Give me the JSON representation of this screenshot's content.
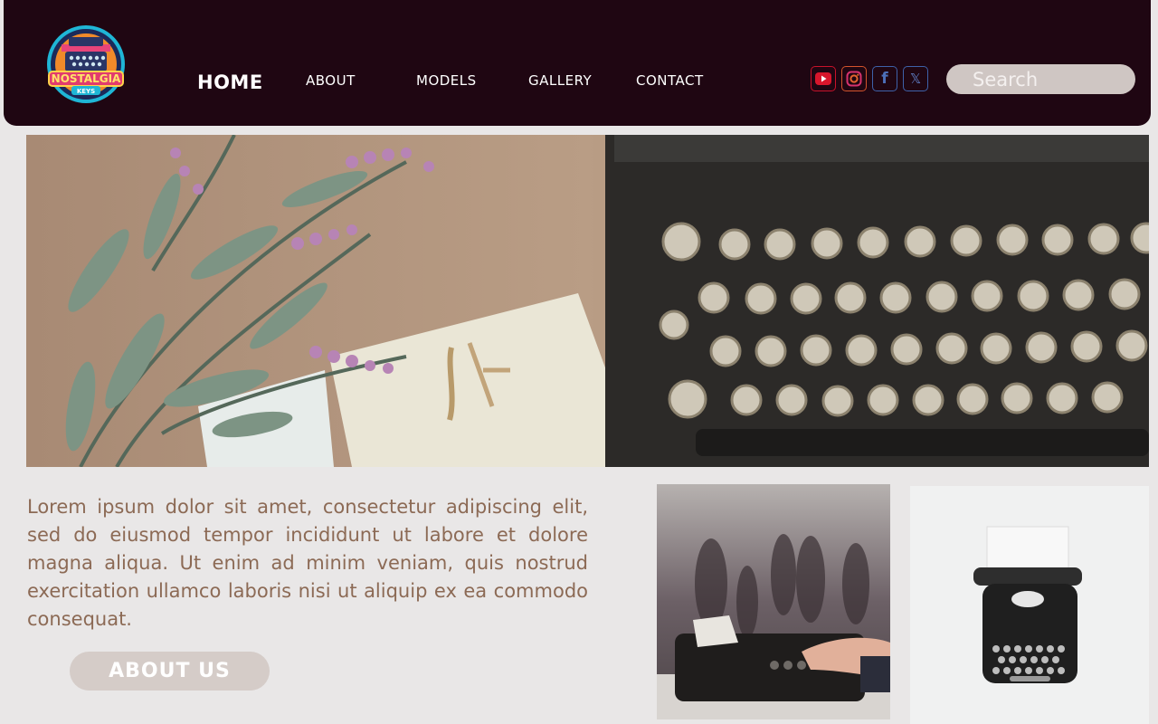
{
  "brand": {
    "logo_text_1": "NOSTALGIA",
    "logo_text_2": "KEYS"
  },
  "nav": {
    "home": "HOME",
    "about": "ABOUT",
    "models": "MODELS",
    "gallery": "GALLERY",
    "contact": "CONTACT"
  },
  "social": {
    "youtube_icon": "youtube-icon",
    "instagram_icon": "instagram-icon",
    "facebook_icon": "facebook-icon",
    "x_icon": "x-icon",
    "fb_glyph": "f",
    "x_glyph": "𝕏"
  },
  "search": {
    "placeholder": "Search"
  },
  "content": {
    "paragraph": "Lorem ipsum dolor sit amet, consectetur adipiscing elit, sed do eiusmod tempor incididunt ut labore et dolore magna aliqua. Ut enim ad minim veniam, quis nostrud exercitation ullamco laboris nisi ut aliquip ex ea commodo consequat.",
    "about_button": "ABOUT US"
  },
  "colors": {
    "header_bg": "#1f0612",
    "page_bg": "#e9e7e7",
    "text_brown": "#8c6a55",
    "button_bg": "#d5ccc8",
    "search_bg": "#cfc6c3"
  }
}
